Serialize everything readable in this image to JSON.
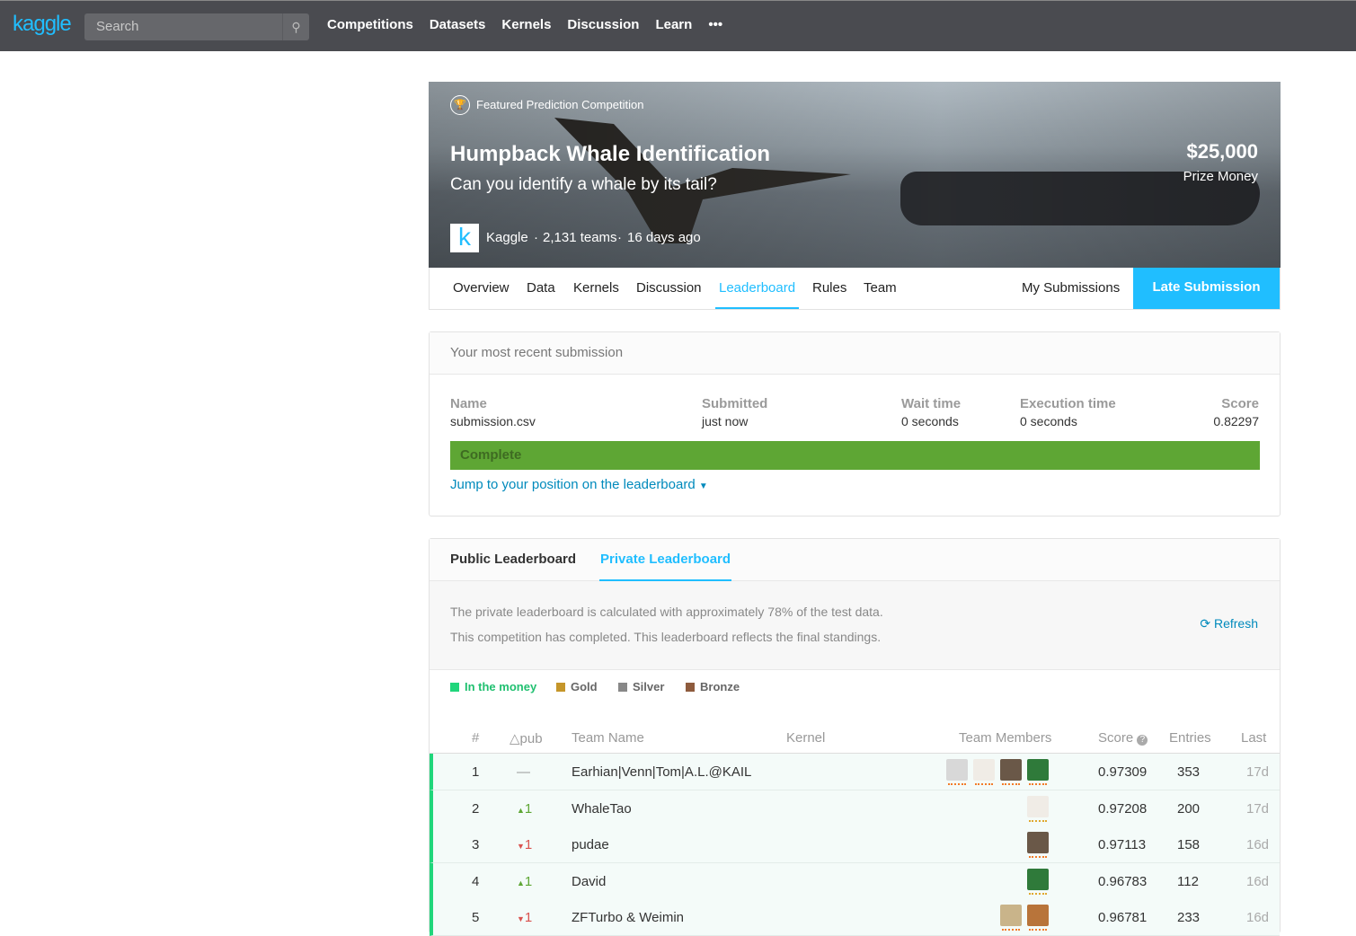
{
  "nav": {
    "logo": "kaggle",
    "search_placeholder": "Search",
    "links": [
      "Competitions",
      "Datasets",
      "Kernels",
      "Discussion",
      "Learn"
    ],
    "more": "•••"
  },
  "banner": {
    "category": "Featured Prediction Competition",
    "title": "Humpback Whale Identification",
    "subtitle": "Can you identify a whale by its tail?",
    "host": "Kaggle",
    "teams": "2,131 teams",
    "age": "16 days ago",
    "prize": "$25,000",
    "prize_label": "Prize Money",
    "host_logo": "k"
  },
  "tabs": {
    "items": [
      "Overview",
      "Data",
      "Kernels",
      "Discussion",
      "Leaderboard",
      "Rules",
      "Team"
    ],
    "active": "Leaderboard",
    "my_submissions": "My Submissions",
    "late_submission": "Late Submission"
  },
  "submission": {
    "header": "Your most recent submission",
    "name_label": "Name",
    "name": "submission.csv",
    "submitted_label": "Submitted",
    "submitted": "just now",
    "wait_label": "Wait time",
    "wait": "0 seconds",
    "exec_label": "Execution time",
    "exec": "0 seconds",
    "score_label": "Score",
    "score": "0.82297",
    "status": "Complete",
    "jump": "Jump to your position on the leaderboard"
  },
  "leaderboard": {
    "tabs": [
      "Public Leaderboard",
      "Private Leaderboard"
    ],
    "active": "Private Leaderboard",
    "info1": "The private leaderboard is calculated with approximately 78% of the test data.",
    "info2": "This competition has completed. This leaderboard reflects the final standings.",
    "refresh": "Refresh",
    "legend": [
      {
        "label": "In the money",
        "color": "#20d67b"
      },
      {
        "label": "Gold",
        "color": "#c5962a"
      },
      {
        "label": "Silver",
        "color": "#888888"
      },
      {
        "label": "Bronze",
        "color": "#8e5b3d"
      }
    ],
    "columns": [
      "#",
      "△pub",
      "Team Name",
      "Kernel",
      "Team Members",
      "Score",
      "Entries",
      "Last"
    ],
    "rows": [
      {
        "rank": "1",
        "delta": "—",
        "dir": "none",
        "team": "Earhian|Venn|Tom|A.L.@KAIL",
        "members": 4,
        "score": "0.97309",
        "entries": "353",
        "last": "17d"
      },
      {
        "rank": "2",
        "delta": "1",
        "dir": "up",
        "team": "WhaleTao",
        "members": 1,
        "score": "0.97208",
        "entries": "200",
        "last": "17d"
      },
      {
        "rank": "3",
        "delta": "1",
        "dir": "down",
        "team": "pudae",
        "members": 1,
        "score": "0.97113",
        "entries": "158",
        "last": "16d"
      },
      {
        "rank": "4",
        "delta": "1",
        "dir": "up",
        "team": "David",
        "members": 1,
        "score": "0.96783",
        "entries": "112",
        "last": "16d"
      },
      {
        "rank": "5",
        "delta": "1",
        "dir": "down",
        "team": "ZFTurbo & Weimin",
        "members": 2,
        "score": "0.96781",
        "entries": "233",
        "last": "16d"
      }
    ]
  }
}
